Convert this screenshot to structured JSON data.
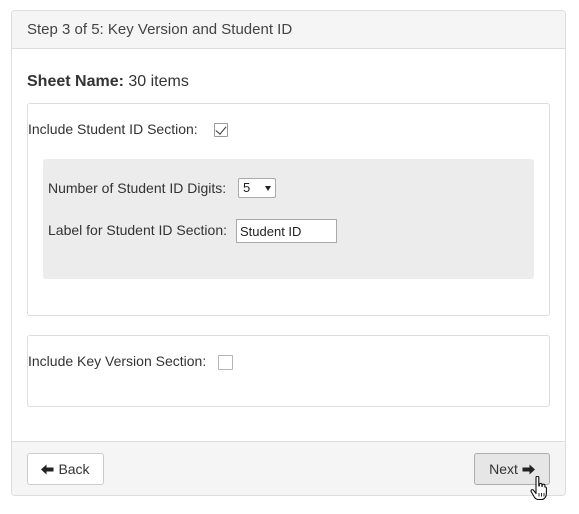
{
  "header": {
    "title": "Step 3 of 5: Key Version and Student ID"
  },
  "sheet": {
    "label": "Sheet Name:",
    "value": "30 items"
  },
  "student_id_section": {
    "include_label": "Include Student ID Section:",
    "include_checked": true,
    "digits_label": "Number of Student ID Digits:",
    "digits_value": "5",
    "section_label_label": "Label for Student ID Section:",
    "section_label_value": "Student ID"
  },
  "key_version_section": {
    "include_label": "Include Key Version Section:",
    "include_checked": false
  },
  "footer": {
    "back_label": "Back",
    "next_label": "Next"
  },
  "icons": {
    "back": "arrow-left-icon",
    "next": "arrow-right-icon",
    "cursor": "hand-pointer-icon"
  },
  "colors": {
    "header_bg": "#f5f5f5",
    "inner_gray": "#ececec",
    "border": "#dddddd"
  }
}
